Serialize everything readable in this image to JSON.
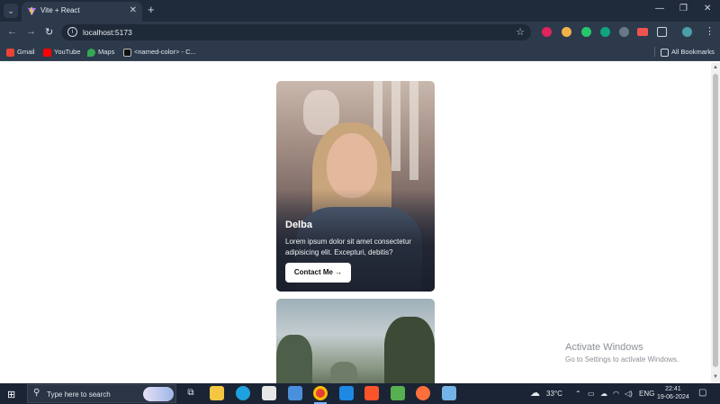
{
  "browser": {
    "tab_title": "Vite + React",
    "url": "localhost:5173",
    "tab_close": "✕",
    "new_tab": "+",
    "menu": "⌄"
  },
  "window_controls": {
    "minimize": "—",
    "restore": "❐",
    "close": "✕"
  },
  "nav": {
    "back": "←",
    "forward": "→",
    "reload": "↻"
  },
  "bookmarks": [
    {
      "label": "Gmail",
      "icon": "gmail-icon",
      "color": "#ea4335"
    },
    {
      "label": "YouTube",
      "icon": "youtube-icon",
      "color": "#ff0000"
    },
    {
      "label": "Maps",
      "icon": "maps-icon",
      "color": "#34a853"
    },
    {
      "label": "<named-color> - C...",
      "icon": "mdn-icon",
      "color": "#111111"
    }
  ],
  "all_bookmarks": "All Bookmarks",
  "cards": [
    {
      "name": "Delba",
      "description": "Lorem ipsum dolor sit amet consectetur adipisicing elit. Excepturi, debitis?",
      "button": "Contact Me →"
    }
  ],
  "watermark": {
    "title": "Activate Windows",
    "subtitle": "Go to Settings to activate Windows."
  },
  "taskbar": {
    "search_placeholder": "Type here to search",
    "weather": "33°C",
    "language": "ENG",
    "time": "22:41",
    "date": "19-06-2024"
  }
}
